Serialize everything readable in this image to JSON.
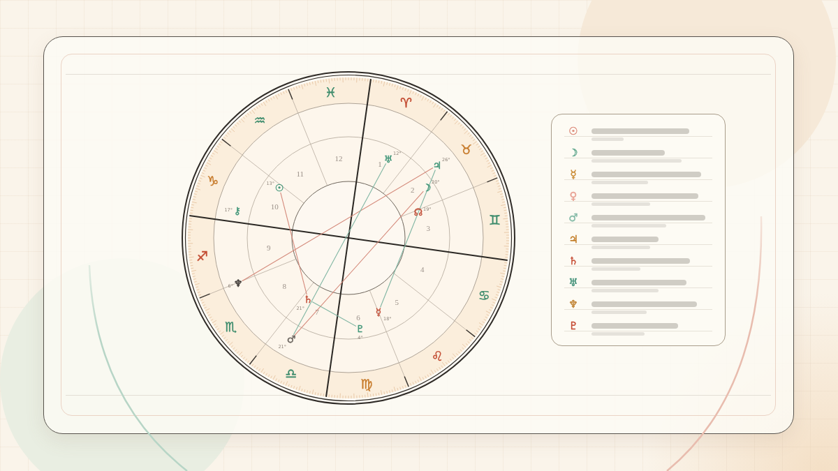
{
  "chart": {
    "signs": [
      {
        "symbol": "♈",
        "color": "#c24a30"
      },
      {
        "symbol": "♉",
        "color": "#c77b2b"
      },
      {
        "symbol": "♊",
        "color": "#3b8b6b"
      },
      {
        "symbol": "♋",
        "color": "#3b8b6b"
      },
      {
        "symbol": "♌",
        "color": "#c24a30"
      },
      {
        "symbol": "♍",
        "color": "#c77b2b"
      },
      {
        "symbol": "♎",
        "color": "#3b8b6b"
      },
      {
        "symbol": "♏",
        "color": "#3b8b6b"
      },
      {
        "symbol": "♐",
        "color": "#c24a30"
      },
      {
        "symbol": "♑",
        "color": "#c77b2b"
      },
      {
        "symbol": "♒",
        "color": "#3b8b6b"
      },
      {
        "symbol": "♓",
        "color": "#3b8b6b"
      }
    ],
    "houses": [
      "1",
      "2",
      "3",
      "4",
      "5",
      "6",
      "7",
      "8",
      "9",
      "10",
      "11",
      "12"
    ],
    "planets": [
      {
        "symbol": "♅",
        "degree": "12°",
        "color": "#3f9577"
      },
      {
        "symbol": "♃",
        "degree": "26°",
        "color": "#3f9577"
      },
      {
        "symbol": "☉",
        "degree": "13°",
        "color": "#3f9577"
      },
      {
        "symbol": "☽",
        "degree": "20°",
        "color": "#3f9577"
      },
      {
        "symbol": "⚷",
        "degree": "17°",
        "color": "#3f9577"
      },
      {
        "symbol": "☊",
        "degree": "19°",
        "color": "#c2503a"
      },
      {
        "symbol": "♆",
        "degree": "6°",
        "color": "#3a3531"
      },
      {
        "symbol": "♄",
        "degree": "21°",
        "color": "#c2503a"
      },
      {
        "symbol": "☿",
        "degree": "18°",
        "color": "#c2503a"
      },
      {
        "symbol": "♇",
        "degree": "4°",
        "color": "#3f9577"
      },
      {
        "symbol": "♂",
        "degree": "21°",
        "color": "#6a645e"
      }
    ],
    "aspects": [
      {
        "color": "#d4897a"
      },
      {
        "color": "#d4897a"
      },
      {
        "color": "#d4897a"
      },
      {
        "color": "#7fb5a2"
      },
      {
        "color": "#7fb5a2"
      },
      {
        "color": "#7fb5a2"
      }
    ]
  },
  "legend": {
    "items": [
      {
        "symbol": "☉",
        "color": "#dd8e7e"
      },
      {
        "symbol": "☽",
        "color": "#62a88f"
      },
      {
        "symbol": "☿",
        "color": "#c98a33"
      },
      {
        "symbol": "♀",
        "color": "#e9a395"
      },
      {
        "symbol": "♂",
        "color": "#86bba8"
      },
      {
        "symbol": "♃",
        "color": "#c27c25"
      },
      {
        "symbol": "♄",
        "color": "#c8543c"
      },
      {
        "symbol": "♅",
        "color": "#3f8f76"
      },
      {
        "symbol": "♆",
        "color": "#c08232"
      },
      {
        "symbol": "♇",
        "color": "#c4472f"
      }
    ]
  }
}
